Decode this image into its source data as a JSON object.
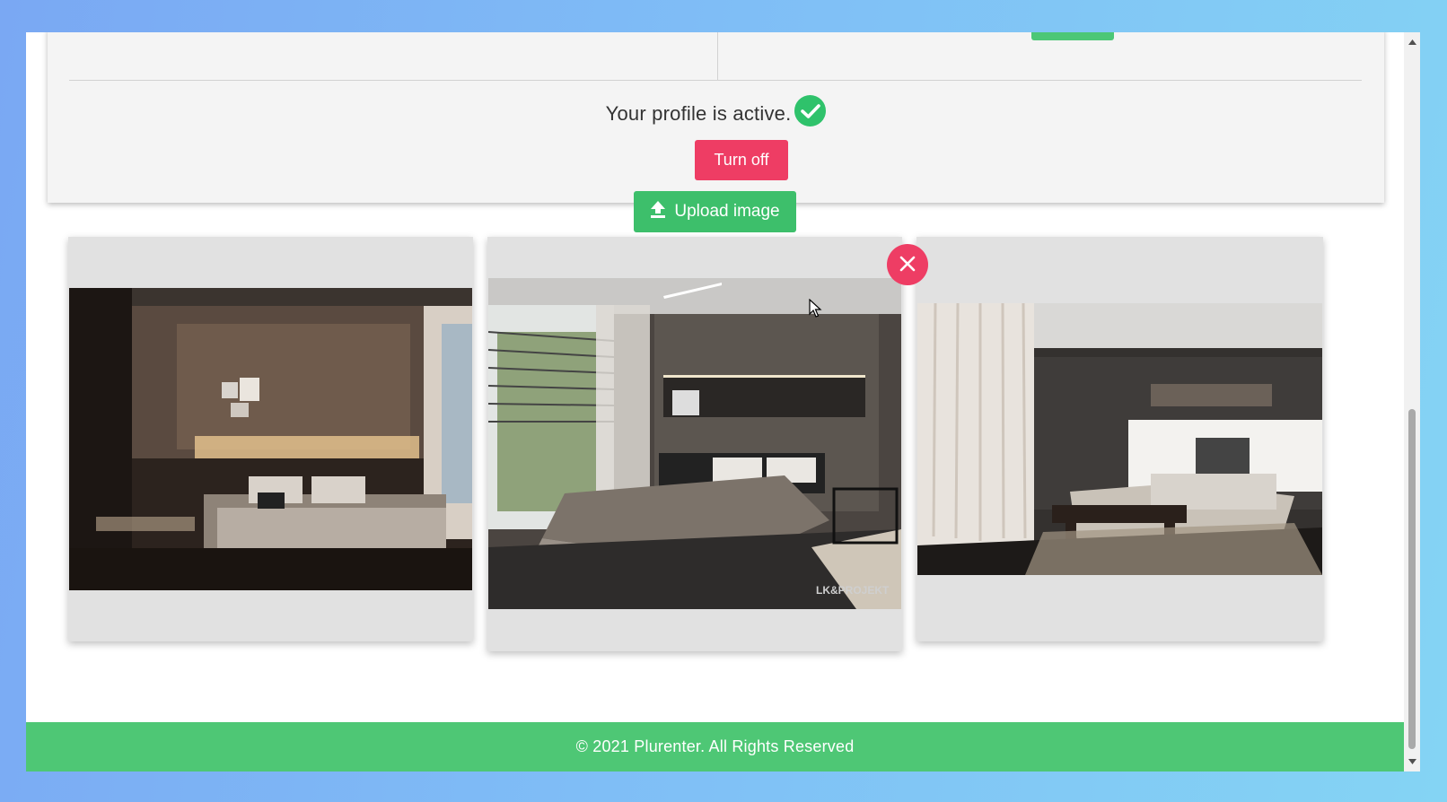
{
  "profile": {
    "status_text": "Your profile is active.",
    "turn_off_label": "Turn off"
  },
  "upload": {
    "label": "Upload image",
    "icon": "upload-icon"
  },
  "gallery": {
    "items": [
      {
        "name": "bedroom-photo-1",
        "removable": false
      },
      {
        "name": "bedroom-photo-2",
        "removable": true,
        "watermark": "LK&PROJEKT"
      },
      {
        "name": "bedroom-photo-3",
        "removable": false
      }
    ]
  },
  "footer": {
    "text": "© 2021 Plurenter. All Rights Reserved"
  },
  "colors": {
    "primary_green": "#4ec775",
    "danger_pink": "#ee3d64",
    "check_green": "#2fc26b"
  }
}
